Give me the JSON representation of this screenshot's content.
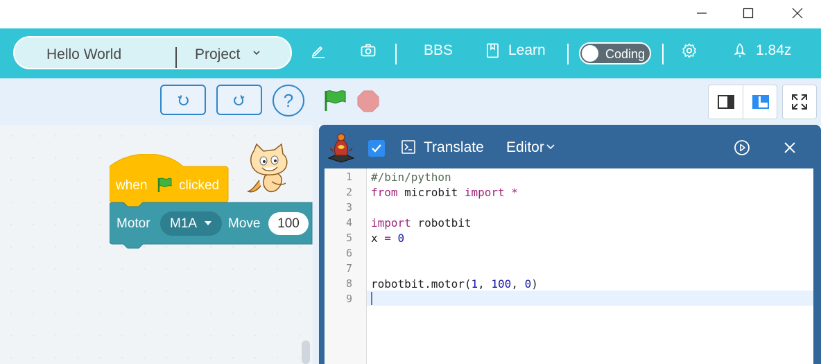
{
  "window": {
    "minimize_icon": "minimize-icon",
    "maximize_icon": "maximize-icon",
    "close_icon": "close-icon"
  },
  "header": {
    "project_name": "Hello World",
    "project_menu": "Project",
    "bbs_label": "BBS",
    "learn_label": "Learn",
    "coding_label": "Coding",
    "version_label": "1.84z",
    "accent": "#33c5d6"
  },
  "toolbar": {
    "help_label": "?",
    "green_flag_color": "#3fb43f",
    "stop_color": "#e89a9a"
  },
  "blocks": {
    "hat_when": "when",
    "hat_clicked": "clicked",
    "motor_label": "Motor",
    "motor_port": "M1A",
    "move_label": "Move",
    "move_value": "100",
    "hat_color": "#ffbf00",
    "motor_color": "#3d9aa9"
  },
  "code_panel": {
    "translate_label": "Translate",
    "editor_label": "Editor",
    "checkbox_checked": true,
    "line_numbers": [
      "1",
      "2",
      "3",
      "4",
      "5",
      "6",
      "7",
      "8",
      "9"
    ],
    "active_line": 9
  }
}
